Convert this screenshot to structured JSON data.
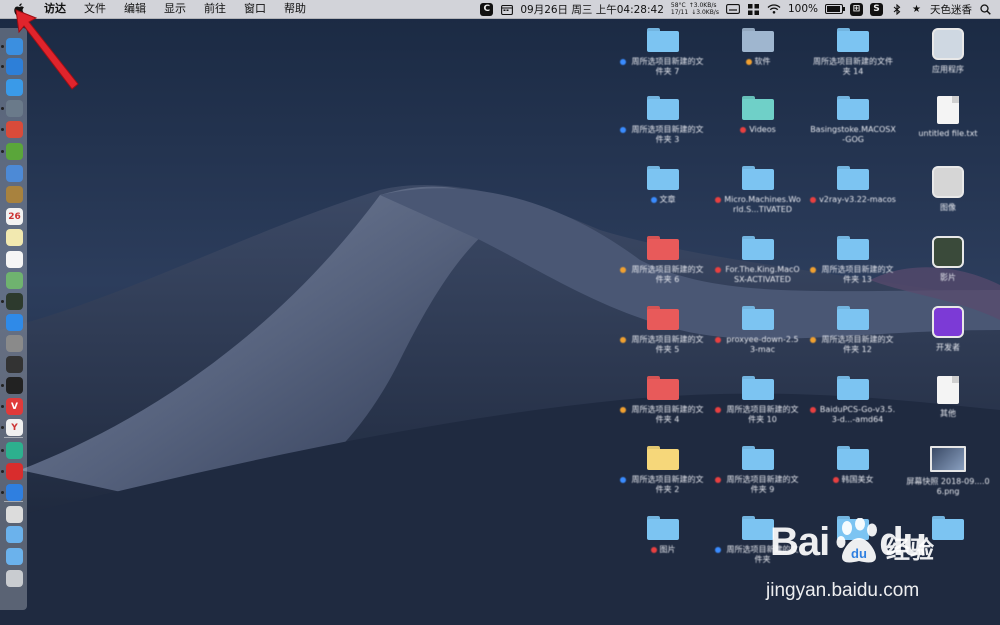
{
  "menubar": {
    "apple_icon": "apple-logo-icon",
    "app_name": "访达",
    "menus": [
      "文件",
      "编辑",
      "显示",
      "前往",
      "窗口",
      "帮助"
    ],
    "status": {
      "c_badge": "C",
      "datetime": "09月26日 周三 上午04:28:42",
      "cpu_temp": "58°C",
      "cpu_usage": "17/11",
      "upload": "↑3.0KB/s",
      "download": "↓3.0KB/s",
      "battery_percent": "100%",
      "battery_level": 1.0,
      "s_badge": "S",
      "user": "天色迷香"
    }
  },
  "dock": {
    "items": [
      {
        "name": "finder",
        "color": "#3b8fe0",
        "glyph": ""
      },
      {
        "name": "safari",
        "color": "#2d7fd8",
        "glyph": ""
      },
      {
        "name": "safari-compass",
        "color": "#3a9ae8",
        "glyph": ""
      },
      {
        "name": "launchpad",
        "color": "#6a7a8a",
        "glyph": ""
      },
      {
        "name": "app-red",
        "color": "#d94b3a",
        "glyph": ""
      },
      {
        "name": "android-studio",
        "color": "#5aa63a",
        "glyph": ""
      },
      {
        "name": "preview",
        "color": "#4d8ad6",
        "glyph": ""
      },
      {
        "name": "notes-brown",
        "color": "#a8823e",
        "glyph": ""
      },
      {
        "name": "calendar",
        "color": "#f2f2f2",
        "glyph": "26"
      },
      {
        "name": "notes",
        "color": "#f2e9b0",
        "glyph": ""
      },
      {
        "name": "reminders",
        "color": "#f5f5f5",
        "glyph": ""
      },
      {
        "name": "maps",
        "color": "#6fb36f",
        "glyph": ""
      },
      {
        "name": "terminal-dark",
        "color": "#2d3a2d",
        "glyph": ""
      },
      {
        "name": "app-store",
        "color": "#2f8ae8",
        "glyph": ""
      },
      {
        "name": "system-preferences",
        "color": "#8a8a8a",
        "glyph": ""
      },
      {
        "name": "activity-monitor",
        "color": "#333333",
        "glyph": ""
      },
      {
        "name": "terminal",
        "color": "#222222",
        "glyph": ""
      },
      {
        "name": "vivaldi",
        "color": "#e03a3a",
        "glyph": "V"
      },
      {
        "name": "yandex",
        "color": "#f0f0f0",
        "glyph": "Y"
      },
      {
        "name": "app-teal",
        "color": "#2db08e",
        "glyph": ""
      },
      {
        "name": "netease-music",
        "color": "#d92d2d",
        "glyph": ""
      },
      {
        "name": "baidu-netdisk",
        "color": "#2f7fe0",
        "glyph": ""
      },
      {
        "name": "preview-doc",
        "color": "#dcdcdc",
        "glyph": ""
      },
      {
        "name": "folder-applications",
        "color": "#6bb2ec",
        "glyph": ""
      },
      {
        "name": "folder-downloads",
        "color": "#6bb2ec",
        "glyph": ""
      },
      {
        "name": "trash",
        "color": "#c9ccd0",
        "glyph": ""
      }
    ]
  },
  "desktop": {
    "icons": [
      {
        "label": "周所选项目新建的文件夹 7",
        "kind": "folder",
        "color": "#7cc4f2",
        "tag": "#3a8cff"
      },
      {
        "label": "软件",
        "kind": "folder-app",
        "color": "#9fb6cf",
        "tag": "#f0a030"
      },
      {
        "label": "周所选项目新建的文件夹 14",
        "kind": "folder",
        "color": "#7cc4f2",
        "tag": ""
      },
      {
        "label": "应用程序",
        "kind": "app",
        "color": "#cfd8e2",
        "tag": ""
      },
      {
        "label": "周所选项目新建的文件夹 3",
        "kind": "folder",
        "color": "#7cc4f2",
        "tag": "#3a8cff"
      },
      {
        "label": "Videos",
        "kind": "folder",
        "color": "#6fd0c8",
        "tag": "#e84040"
      },
      {
        "label": "Basingstoke.MACOSX-GOG",
        "kind": "folder",
        "color": "#7cc4f2",
        "tag": ""
      },
      {
        "label": "untitled file.txt",
        "kind": "file",
        "color": "#f4f4f4",
        "tag": ""
      },
      {
        "label": "文章",
        "kind": "folder",
        "color": "#7cc4f2",
        "tag": "#3a8cff"
      },
      {
        "label": "Micro.Machines.World.S...TIVATED",
        "kind": "folder",
        "color": "#7cc4f2",
        "tag": "#e84040"
      },
      {
        "label": "v2ray-v3.22-macos",
        "kind": "folder",
        "color": "#7cc4f2",
        "tag": "#e84040"
      },
      {
        "label": "图像",
        "kind": "app",
        "color": "#d6d6d6",
        "tag": ""
      },
      {
        "label": "周所选项目新建的文件夹 6",
        "kind": "folder",
        "color": "#e85a5a",
        "tag": "#f0a030"
      },
      {
        "label": "For.The.King.MacOSX-ACTIVATED",
        "kind": "folder",
        "color": "#7cc4f2",
        "tag": "#e84040"
      },
      {
        "label": "周所选项目新建的文件夹 13",
        "kind": "folder",
        "color": "#7cc4f2",
        "tag": "#f0a030"
      },
      {
        "label": "影片",
        "kind": "app",
        "color": "#3a4a3a",
        "tag": ""
      },
      {
        "label": "周所选项目新建的文件夹 5",
        "kind": "folder",
        "color": "#e85a5a",
        "tag": "#f0a030"
      },
      {
        "label": "proxyee-down-2.53-mac",
        "kind": "folder",
        "color": "#7cc4f2",
        "tag": "#e84040"
      },
      {
        "label": "周所选项目新建的文件夹 12",
        "kind": "folder",
        "color": "#7cc4f2",
        "tag": "#f0a030"
      },
      {
        "label": "开发者",
        "kind": "app",
        "color": "#7c3ad6",
        "tag": ""
      },
      {
        "label": "周所选项目新建的文件夹 4",
        "kind": "folder",
        "color": "#e85a5a",
        "tag": "#f0a030"
      },
      {
        "label": "周所选项目新建的文件夹 10",
        "kind": "folder",
        "color": "#7cc4f2",
        "tag": "#e84040"
      },
      {
        "label": "BaiduPCS-Go-v3.5.3-d...-amd64",
        "kind": "folder",
        "color": "#7cc4f2",
        "tag": "#e84040"
      },
      {
        "label": "其他",
        "kind": "file",
        "color": "#f4f4f4",
        "tag": ""
      },
      {
        "label": "周所选项目新建的文件夹 2",
        "kind": "folder",
        "color": "#f6d77a",
        "tag": "#3a8cff"
      },
      {
        "label": "周所选项目新建的文件夹 9",
        "kind": "folder",
        "color": "#7cc4f2",
        "tag": "#e84040"
      },
      {
        "label": "韩国美女",
        "kind": "folder",
        "color": "#7cc4f2",
        "tag": "#e84040"
      },
      {
        "label": "屏幕快照 2018-09....06.png",
        "kind": "image",
        "color": "#dcdcdc",
        "tag": ""
      },
      {
        "label": "图片",
        "kind": "folder",
        "color": "#7cc4f2",
        "tag": "#e84040"
      },
      {
        "label": "周所选项目新建的文件夹",
        "kind": "folder",
        "color": "#7cc4f2",
        "tag": "#3a8cff"
      },
      {
        "label": "",
        "kind": "folder",
        "color": "#7cc4f2",
        "tag": ""
      },
      {
        "label": "",
        "kind": "folder",
        "color": "#7cc4f2",
        "tag": ""
      }
    ]
  },
  "watermark": {
    "brand": "Bai",
    "brand_tail": "du",
    "cn": "经验",
    "url": "jingyan.baidu.com"
  },
  "colors": {
    "menubar_bg": "#e2e2e6",
    "sky_top": "#1b2a44",
    "sky_bottom": "#3b4e6e",
    "dune": "#5d6b86",
    "arrow": "#e0242c"
  }
}
